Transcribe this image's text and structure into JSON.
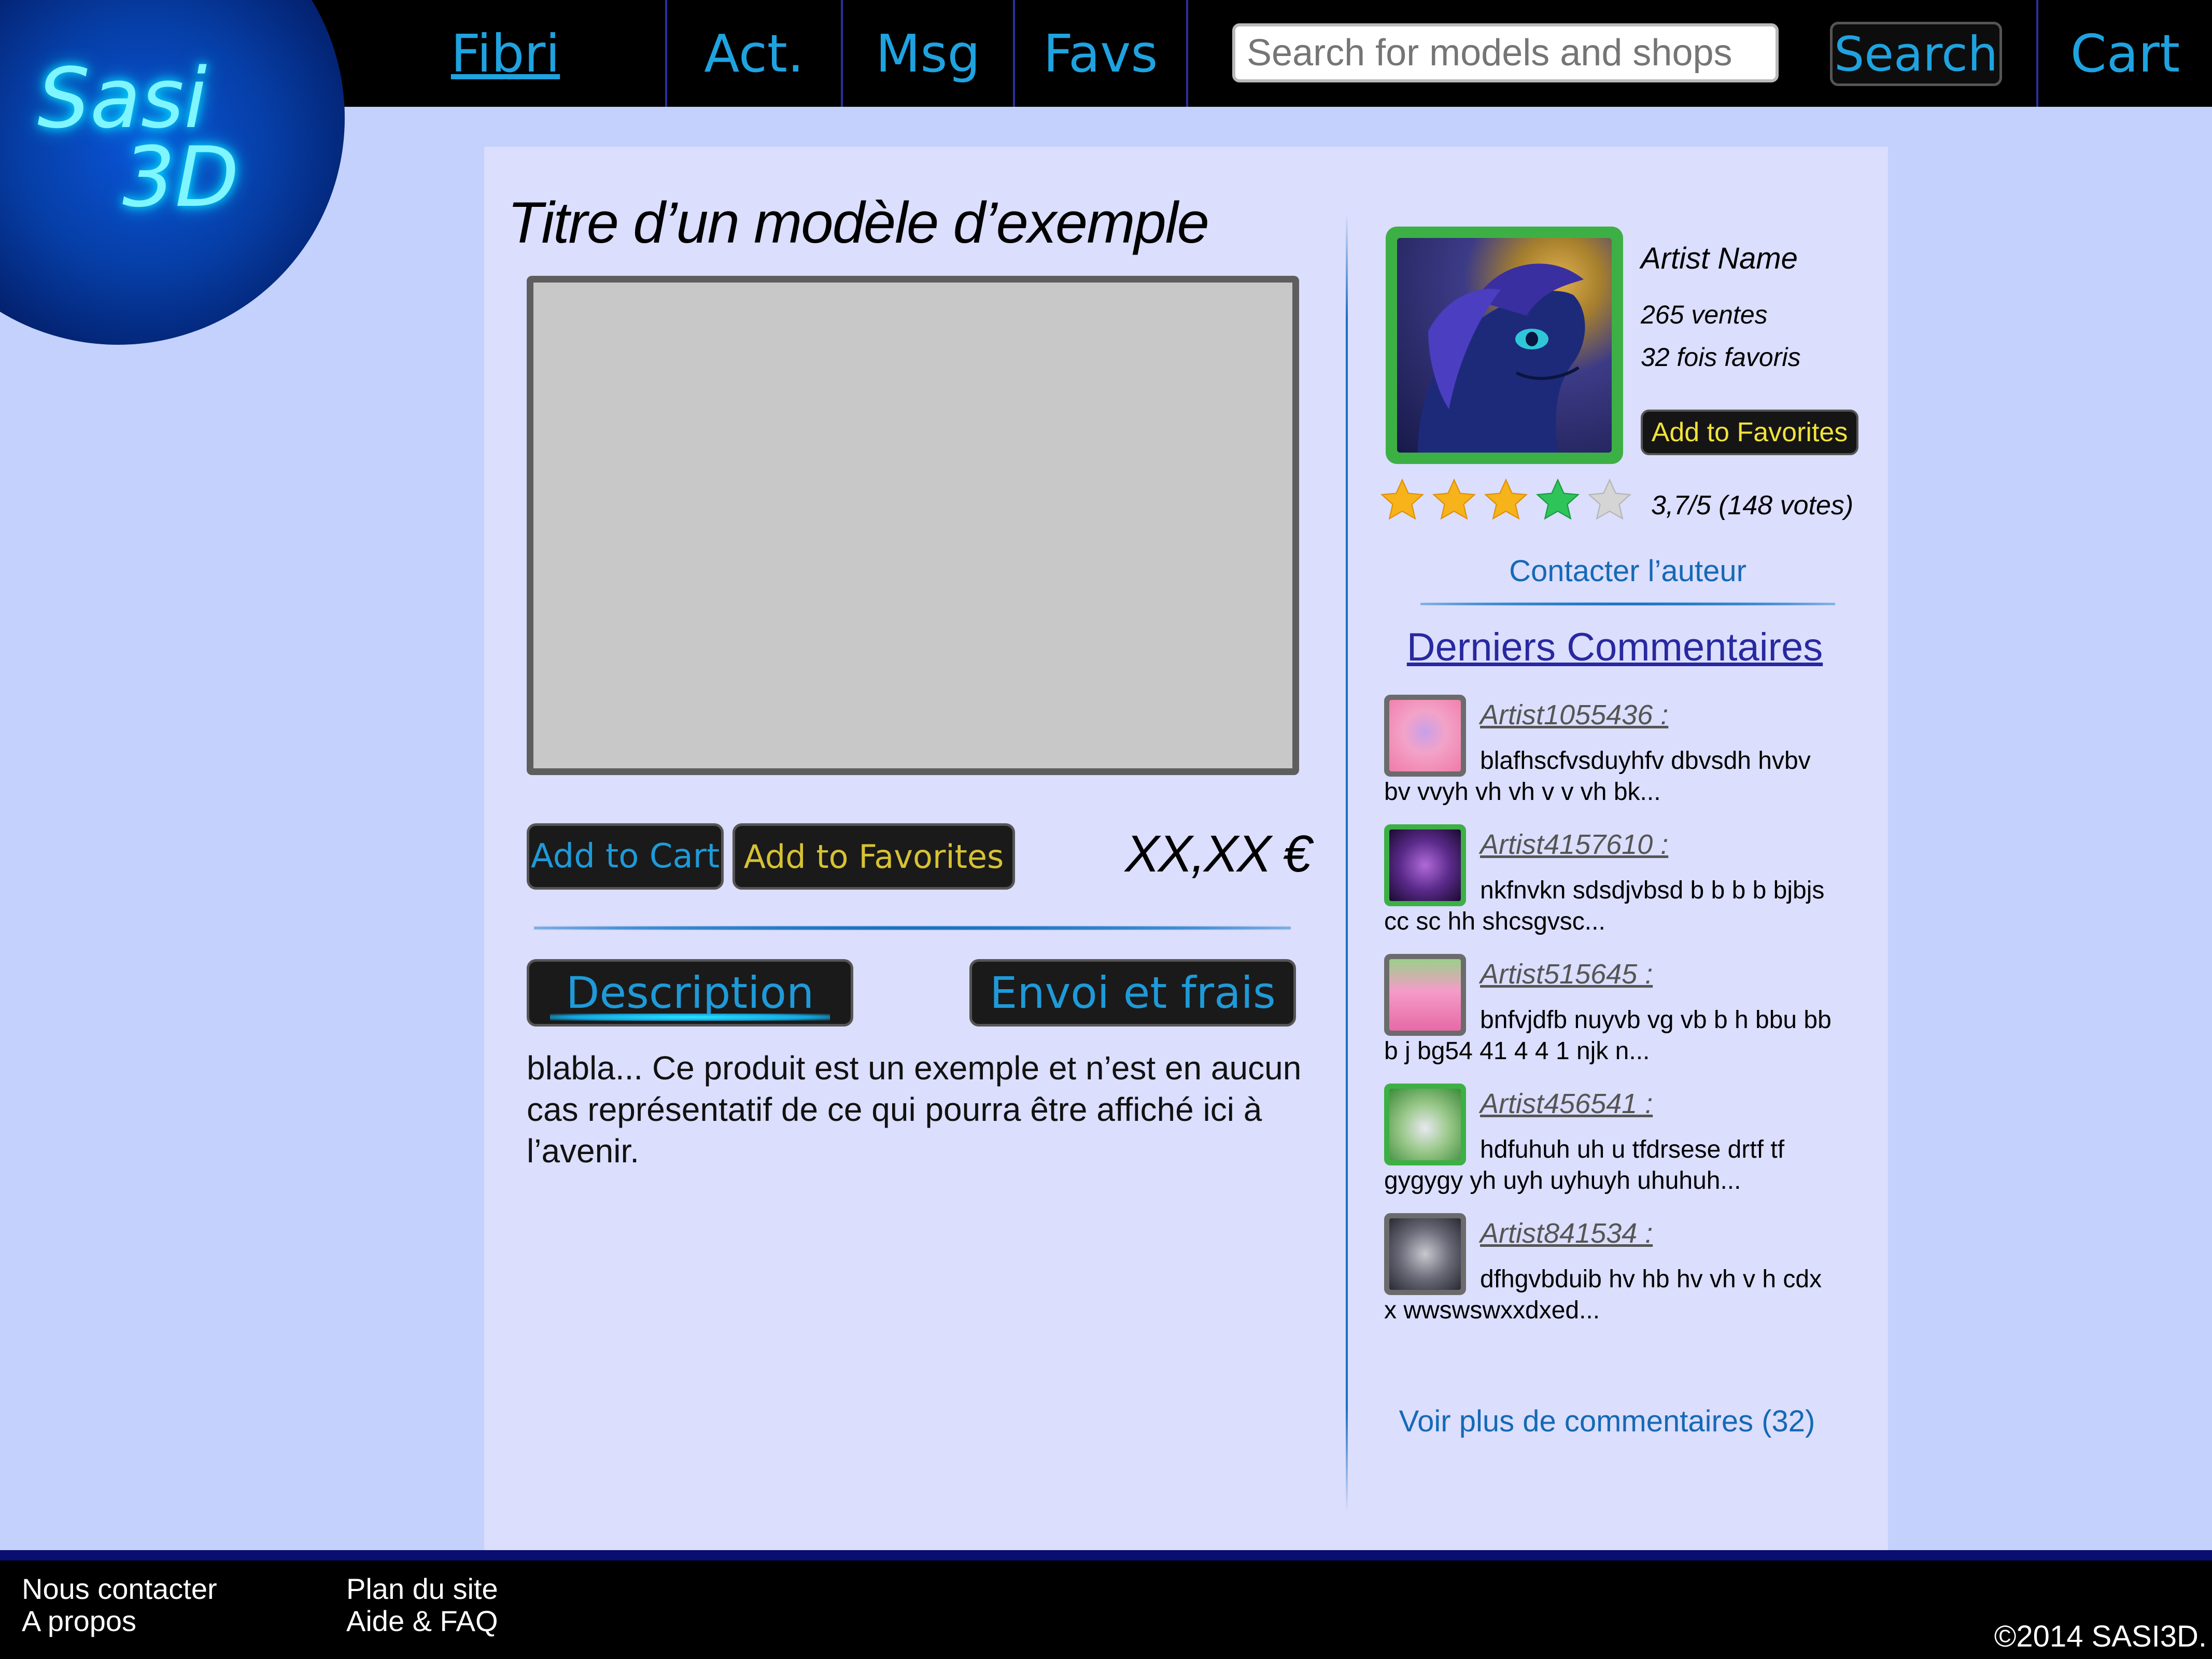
{
  "logo": {
    "line1": "Sasi",
    "line2": "3D"
  },
  "nav": {
    "fibri": "Fibri",
    "act": "Act.",
    "msg": "Msg",
    "favs": "Favs",
    "search_placeholder": "Search for models and shops",
    "search_button": "Search",
    "cart": "Cart"
  },
  "product": {
    "title": "Titre d’un modèle d’exemple",
    "add_to_cart": "Add to Cart",
    "add_to_favorites": "Add to Favorites",
    "price": "XX,XX €",
    "tabs": {
      "description": "Description",
      "shipping": "Envoi et frais"
    },
    "description_text": "blabla... Ce produit est un exemple et n’est en aucun cas représentatif de ce qui pourra être affiché ici à l’avenir."
  },
  "artist": {
    "name": "Artist Name",
    "sales": "265 ventes",
    "favorites": "32 fois favoris",
    "add_to_favorites": "Add to Favorites",
    "rating_stars": 3.7,
    "rating_text": "3,7/5 (148 votes)",
    "contact": "Contacter l’auteur"
  },
  "comments": {
    "heading": "Derniers Commentaires",
    "items": [
      {
        "author": "Artist1055436 :",
        "text": "blafhscfvsduyhfv dbvsdh hvbv bv vvyh vh vh v v vh  bk..."
      },
      {
        "author": "Artist4157610 :",
        "text": "nkfnvkn sdsdjvbsd b b b b bjbjs cc sc hh shcsgvsc..."
      },
      {
        "author": "Artist515645 :",
        "text": "bnfvjdfb nuyvb vg vb b h bbu bb b j bg54 41 4  4  1  njk n..."
      },
      {
        "author": "Artist456541 :",
        "text": "hdfuhuh  uh u tfdrsese drtf tf gygygy yh uyh uyhuyh uhuhuh..."
      },
      {
        "author": "Artist841534 :",
        "text": "dfhgvbduib hv hb hv vh v h cdx  x  wwswswxxdxed..."
      }
    ],
    "more": "Voir plus de commentaires (32)"
  },
  "footer": {
    "contact": "Nous contacter",
    "about": "A propos",
    "sitemap": "Plan du site",
    "help": "Aide & FAQ",
    "copyright": "©2014 SASI3D."
  }
}
